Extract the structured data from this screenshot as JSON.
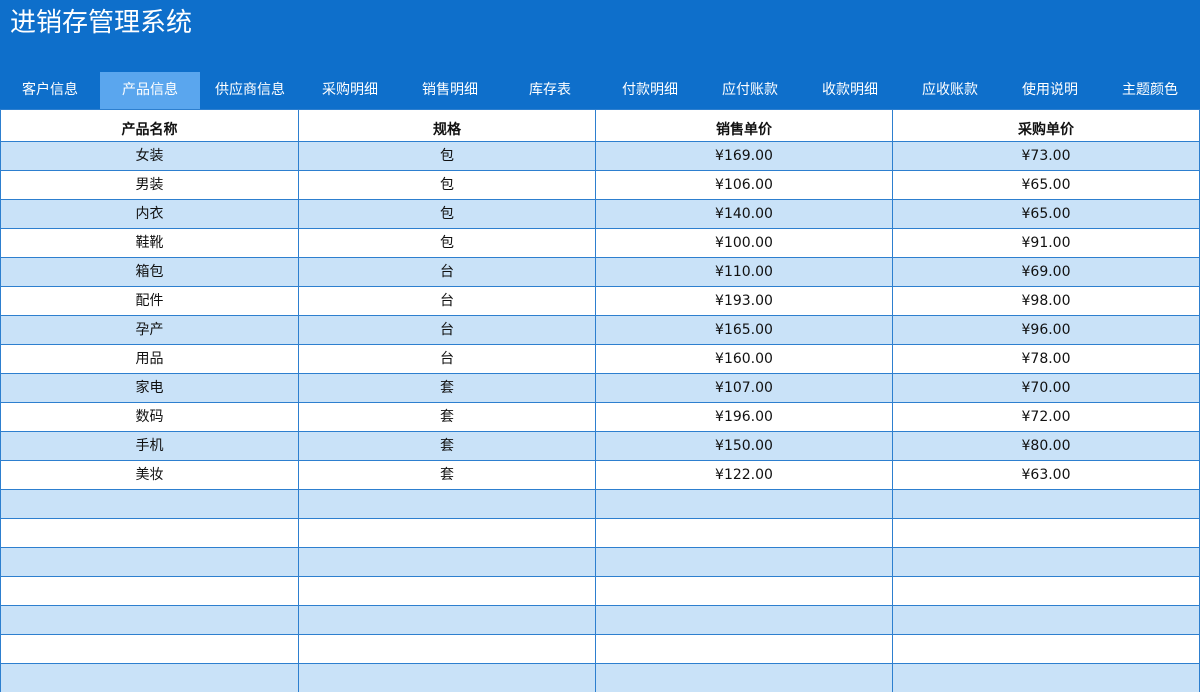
{
  "app": {
    "title": "进销存管理系统"
  },
  "tabs": [
    {
      "label": "客户信息",
      "active": false
    },
    {
      "label": "产品信息",
      "active": true
    },
    {
      "label": "供应商信息",
      "active": false
    },
    {
      "label": "采购明细",
      "active": false
    },
    {
      "label": "销售明细",
      "active": false
    },
    {
      "label": "库存表",
      "active": false
    },
    {
      "label": "付款明细",
      "active": false
    },
    {
      "label": "应付账款",
      "active": false
    },
    {
      "label": "收款明细",
      "active": false
    },
    {
      "label": "应收账款",
      "active": false
    },
    {
      "label": "使用说明",
      "active": false
    },
    {
      "label": "主题颜色",
      "active": false
    }
  ],
  "colors": {
    "header_bg": "#0e6fcb",
    "active_tab_bg": "#5aa6ee",
    "stripe_row_bg": "#c9e2f8",
    "grid_border": "#2d7fcf"
  },
  "table": {
    "columns": [
      "产品名称",
      "规格",
      "销售单价",
      "采购单价"
    ],
    "rows": [
      [
        "女装",
        "包",
        "¥169.00",
        "¥73.00"
      ],
      [
        "男装",
        "包",
        "¥106.00",
        "¥65.00"
      ],
      [
        "内衣",
        "包",
        "¥140.00",
        "¥65.00"
      ],
      [
        "鞋靴",
        "包",
        "¥100.00",
        "¥91.00"
      ],
      [
        "箱包",
        "台",
        "¥110.00",
        "¥69.00"
      ],
      [
        "配件",
        "台",
        "¥193.00",
        "¥98.00"
      ],
      [
        "孕产",
        "台",
        "¥165.00",
        "¥96.00"
      ],
      [
        "用品",
        "台",
        "¥160.00",
        "¥78.00"
      ],
      [
        "家电",
        "套",
        "¥107.00",
        "¥70.00"
      ],
      [
        "数码",
        "套",
        "¥196.00",
        "¥72.00"
      ],
      [
        "手机",
        "套",
        "¥150.00",
        "¥80.00"
      ],
      [
        "美妆",
        "套",
        "¥122.00",
        "¥63.00"
      ],
      [
        "",
        "",
        "",
        ""
      ],
      [
        "",
        "",
        "",
        ""
      ],
      [
        "",
        "",
        "",
        ""
      ],
      [
        "",
        "",
        "",
        ""
      ],
      [
        "",
        "",
        "",
        ""
      ],
      [
        "",
        "",
        "",
        ""
      ],
      [
        "",
        "",
        "",
        ""
      ]
    ]
  }
}
